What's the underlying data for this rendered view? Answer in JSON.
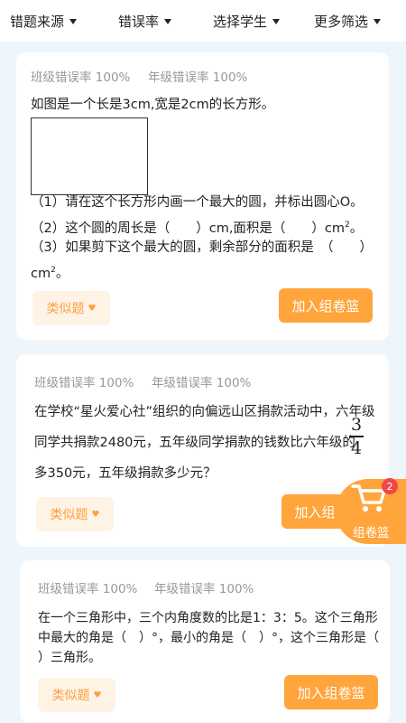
{
  "filters": [
    {
      "label": "错题来源"
    },
    {
      "label": "错误率"
    },
    {
      "label": "选择学生"
    },
    {
      "label": "更多筛选"
    }
  ],
  "questions": [
    {
      "class_rate": "班级错误率 100%",
      "grade_rate": "年级错误率 100%",
      "intro": "如图是一个长是3cm,宽是2cm的长方形。",
      "line1": "（1）请在这个长方形内画一个最大的圆，并标出圆心O。",
      "line2_a": "（2）这个圆的周长是（　　）cm,面积是（　　）cm",
      "line2_b": "。",
      "line3": "（3）如果剪下这个最大的圆，剩余部分的面积是　（　　）",
      "line4": "cm",
      "line4_end": "。",
      "sup": "2",
      "similar_label": "类似题",
      "add_label": "加入组卷篮"
    },
    {
      "class_rate": "班级错误率 100%",
      "grade_rate": "年级错误率 100%",
      "line1": "在学校“星火爱心社”组织的向偏远山区捐款活动中，六年级",
      "line2": "同学共捐款2480元，五年级同学捐款的钱数比六年级的",
      "frac_num": "3",
      "frac_den": "4",
      "line3": "多350元，五年级捐款多少元？",
      "similar_label": "类似题",
      "add_label": "加入组卷篮"
    },
    {
      "class_rate": "班级错误率 100%",
      "grade_rate": "年级错误率 100%",
      "line1": "在一个三角形中，三个内角度数的比是1：3：5。这个三角形",
      "line2": "中最大的角是（　）°，最小的角是（　）°，这个三角形是（",
      "line3": "）三角形。",
      "similar_label": "类似题",
      "add_label": "加入组卷篮"
    }
  ],
  "basket": {
    "count": "2",
    "label": "组卷篮"
  },
  "colors": {
    "accent": "#ffa53c",
    "badge": "#f04848",
    "background": "#eef6fc"
  },
  "icons": {
    "filter_caret": "caret-down-icon",
    "basket": "shopping-cart-icon",
    "similar_heart": "heart-icon"
  }
}
